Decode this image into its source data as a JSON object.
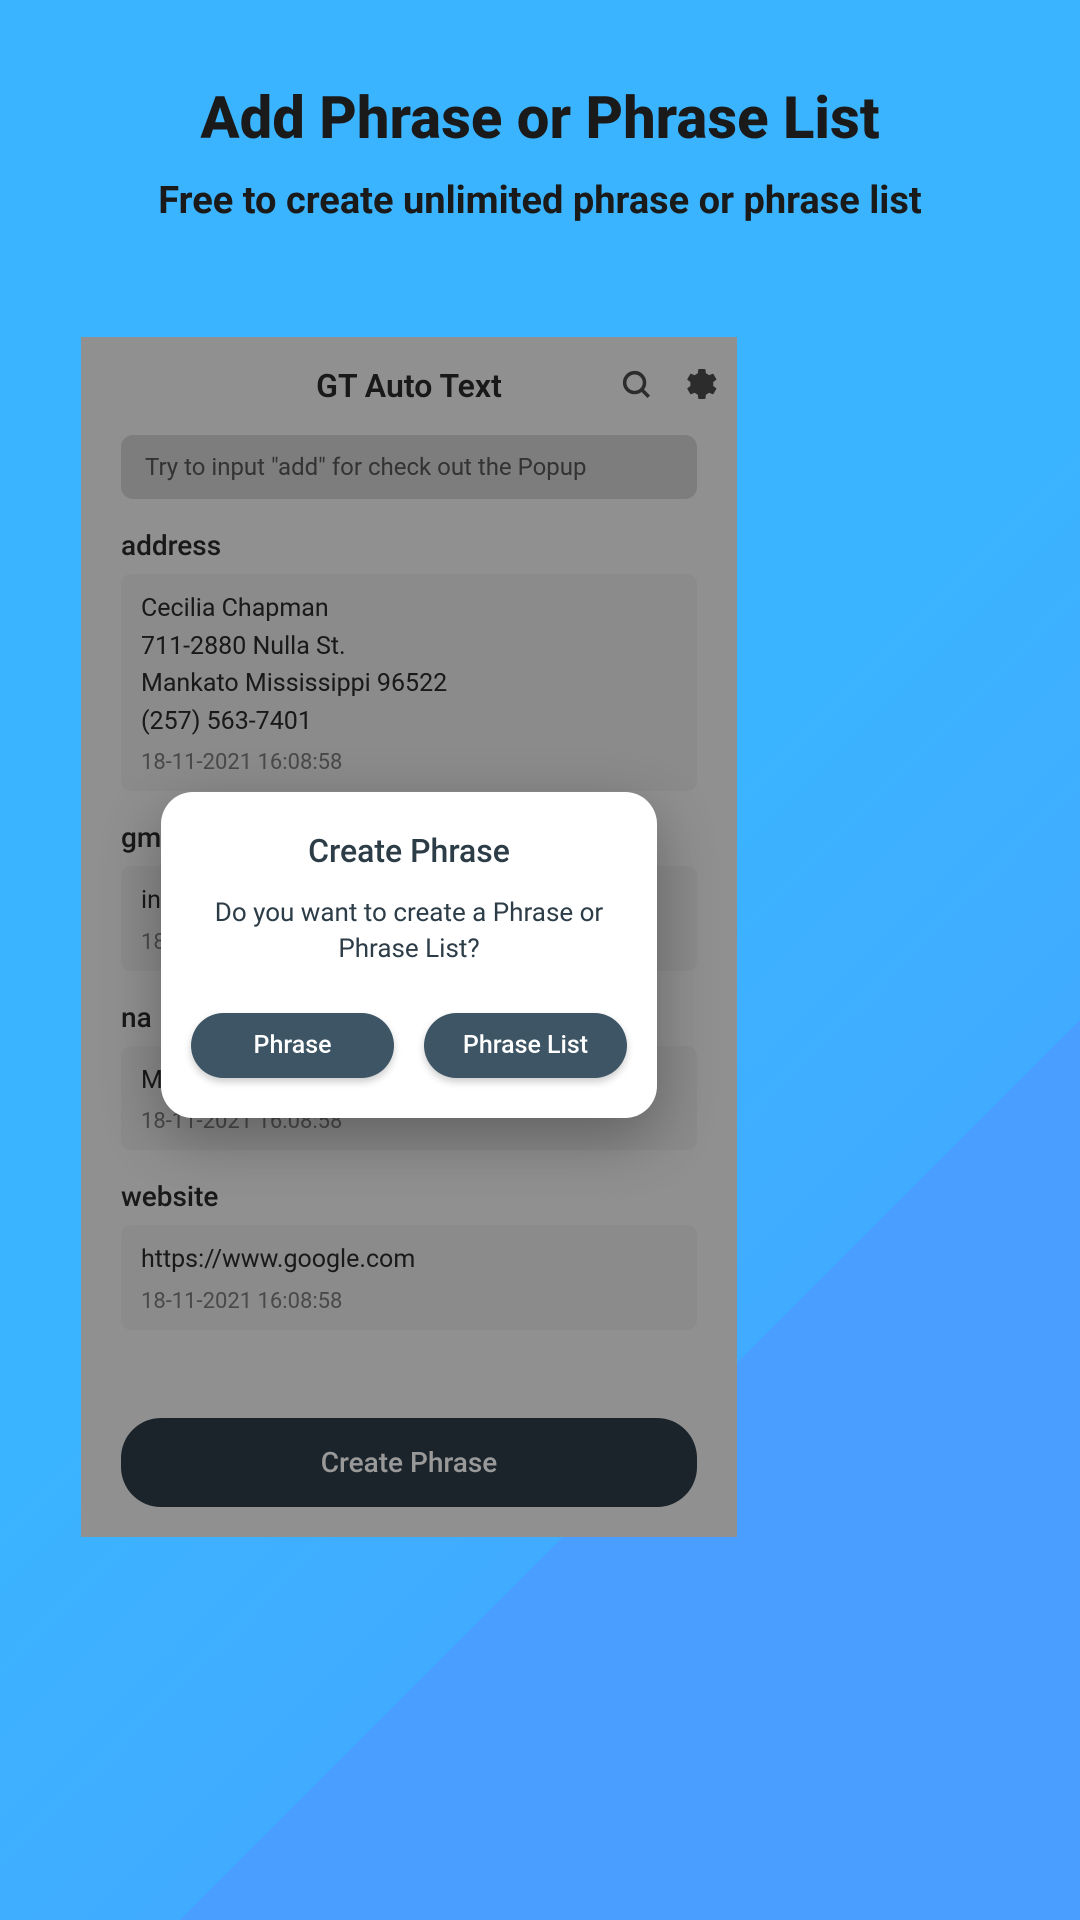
{
  "promo": {
    "title": "Add Phrase or Phrase List",
    "subtitle": "Free to create unlimited phrase or phrase list"
  },
  "app": {
    "title": "GT Auto Text",
    "hint": "Try to input \"add\" for check out the Popup",
    "sections": [
      {
        "label": "address",
        "lines": [
          "Cecilia Chapman",
          "711-2880 Nulla St.",
          "Mankato Mississippi 96522",
          "(257) 563-7401"
        ],
        "timestamp": "18-11-2021 16:08:58"
      },
      {
        "label": "gm",
        "lines": [
          "in"
        ],
        "timestamp": "18"
      },
      {
        "label": "na",
        "lines": [
          "M"
        ],
        "timestamp": "18-11-2021 16:08:58"
      },
      {
        "label": "website",
        "lines": [
          "https://www.google.com"
        ],
        "timestamp": "18-11-2021 16:08:58"
      }
    ],
    "createButton": "Create Phrase"
  },
  "dialog": {
    "title": "Create Phrase",
    "message": "Do you want to create a Phrase or Phrase List?",
    "btnPhrase": "Phrase",
    "btnPhraseList": "Phrase List"
  }
}
